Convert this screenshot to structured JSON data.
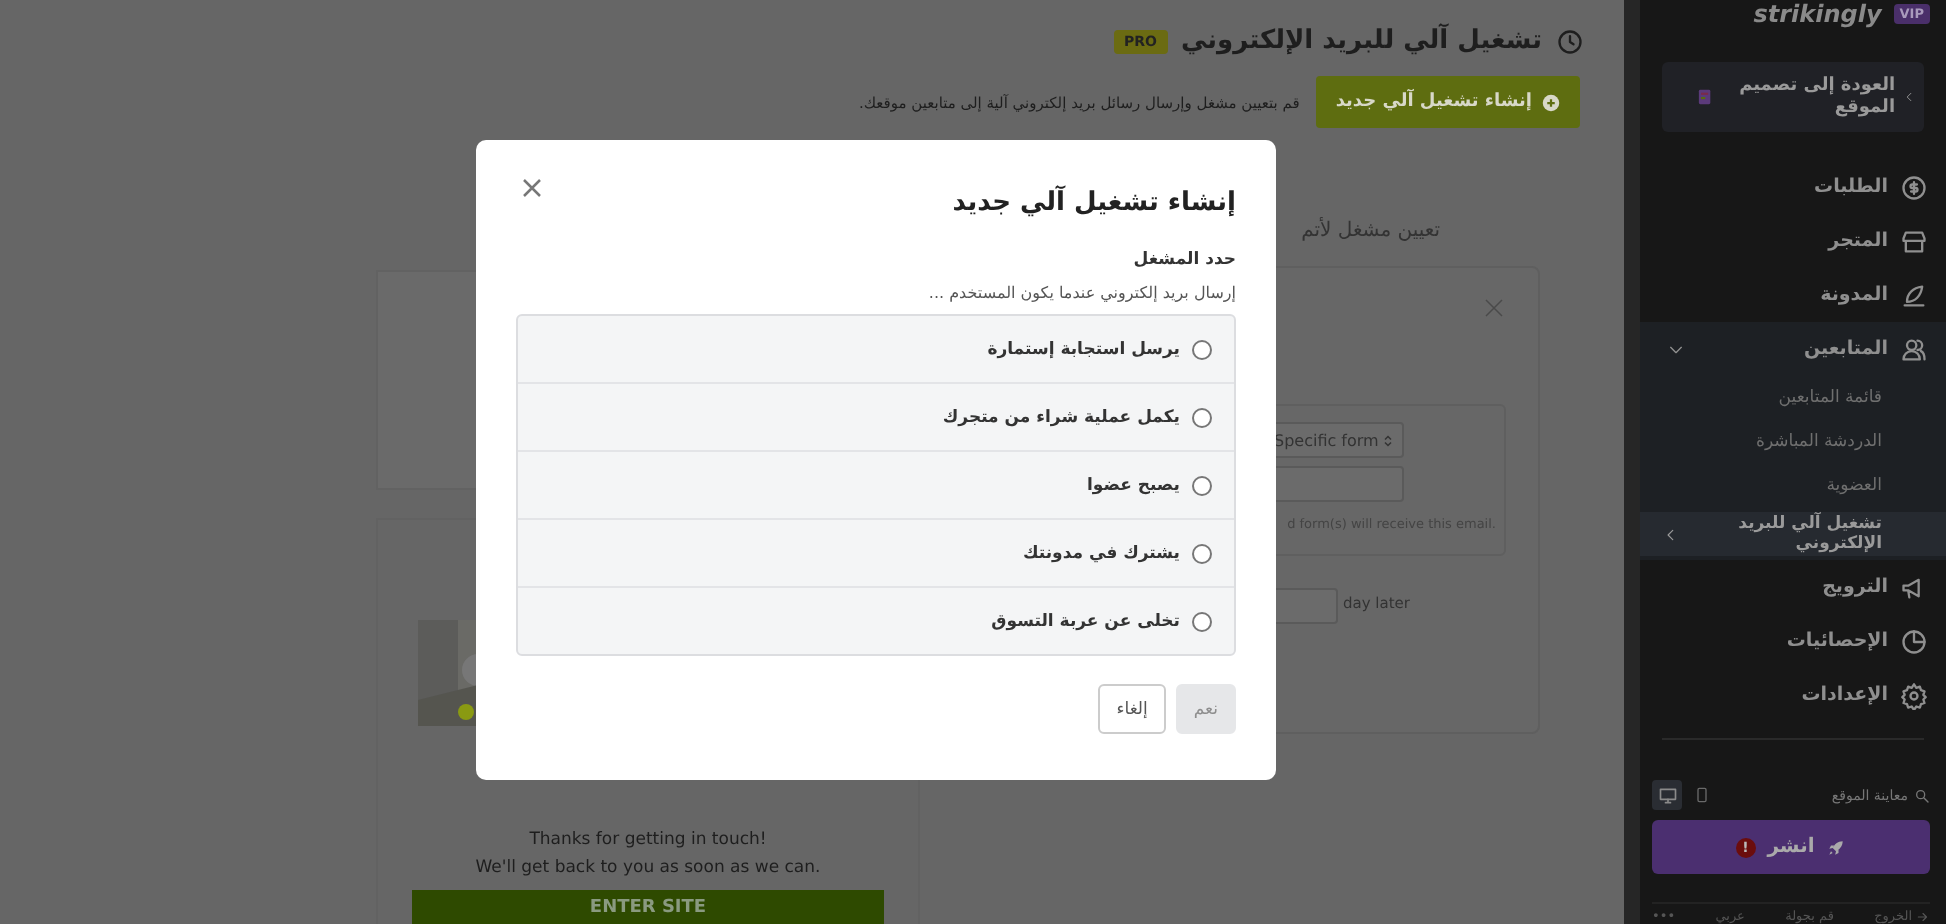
{
  "header": {
    "title": "تشغيل آلي للبريد الإلكتروني",
    "badge": "PRO"
  },
  "create_button": {
    "label": "إنشاء تشغيل آلي جديد"
  },
  "description": "قم بتعيين مشغل وإرسال رسائل بريد إلكتروني آلية إلى متابعين موقعك.",
  "trigger_panel": {
    "heading": "تعيين مشغل لأتم",
    "filter_select": {
      "value": "Specific form"
    },
    "hint": "d form(s) will receive this email.",
    "delay_unit": "day later"
  },
  "preview": {
    "message_lines": [
      "Thanks for getting in touch!",
      "We'll get back to you as soon as we can."
    ],
    "button": "ENTER SITE"
  },
  "modal": {
    "title": "إنشاء تشغيل آلي جديد",
    "section_label": "حدد المشغل",
    "prompt": "إرسال بريد إلكتروني عندما يكون المستخدم ...",
    "options": [
      {
        "label": "يرسل استجابة إستمارة",
        "selected": false
      },
      {
        "label": "يكمل عملية شراء من متجرك",
        "selected": false
      },
      {
        "label": "يصبح عضوا",
        "selected": false
      },
      {
        "label": "يشترك في مدونتك",
        "selected": false
      },
      {
        "label": "تخلى عن عربة التسوق",
        "selected": false
      }
    ],
    "buttons": [
      {
        "label": "نعم",
        "disabled": true
      },
      {
        "label": "إلغاء",
        "disabled": false
      }
    ]
  },
  "sidebar": {
    "badge": "VIP",
    "logo": "strikingly",
    "back_link": "العودة إلى تصميم الموقع",
    "nav": [
      {
        "label": "الطلبات"
      },
      {
        "label": "المتجر"
      },
      {
        "label": "المدونة"
      },
      {
        "label": "المتابعين",
        "expanded": true,
        "children": [
          {
            "label": "قائمة المتابعين",
            "selected": false
          },
          {
            "label": "الدردشة المباشرة",
            "selected": false
          },
          {
            "label": "العضوية",
            "selected": false
          },
          {
            "label": "تشغيل آلي للبريد الإلكتروني",
            "selected": true
          }
        ]
      },
      {
        "label": "الترويج"
      },
      {
        "label": "الإحصائيات"
      },
      {
        "label": "الإعدادات"
      }
    ],
    "preview_label": "معاينة الموقع",
    "devices": [
      {
        "kind": "desktop",
        "selected": true
      },
      {
        "kind": "mobile",
        "selected": false
      }
    ],
    "publish": {
      "label": "انشر",
      "alert": "!"
    },
    "footer": [
      "الخروج",
      "قم بجولة",
      "عربي",
      "•••"
    ]
  }
}
